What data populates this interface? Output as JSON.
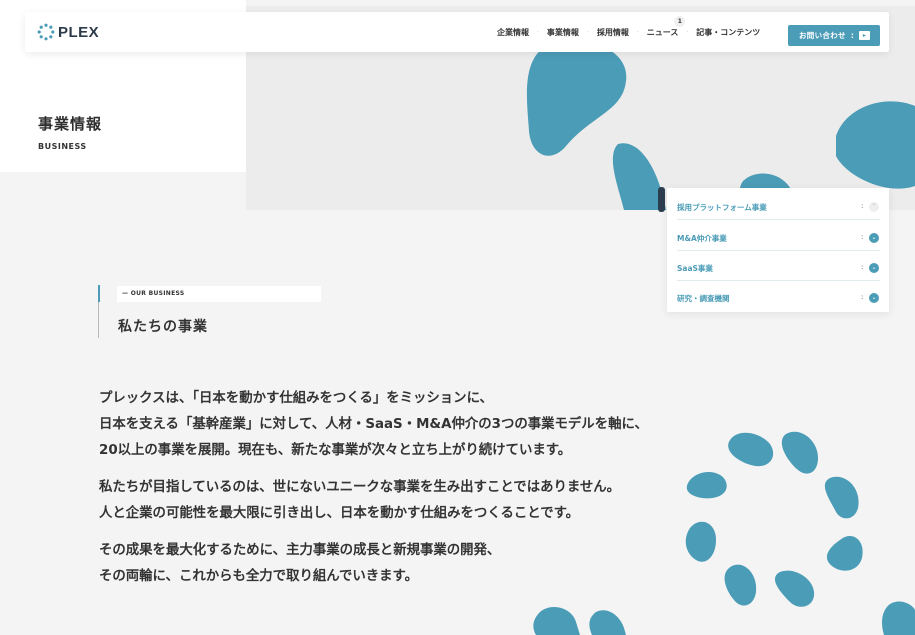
{
  "header": {
    "logo_text": "PLEX",
    "nav": [
      {
        "label": "企業情報"
      },
      {
        "label": "事業情報"
      },
      {
        "label": "採用情報"
      },
      {
        "label": "ニュース",
        "badge": "1"
      },
      {
        "label": "記事・コンテンツ"
      }
    ],
    "contact_label": "お問い合わせ",
    "contact_colon": ":",
    "contact_arrow": "▸"
  },
  "page": {
    "title": "事業情報",
    "subtitle": "BUSINESS"
  },
  "side_menu": {
    "items": [
      {
        "label": "採用プラットフォーム事業",
        "colon": ":",
        "icon": "chevron-up-icon",
        "icon_glyph": "⌃",
        "active": false
      },
      {
        "label": "M&A仲介事業",
        "colon": ":",
        "icon": "chevron-down-icon",
        "icon_glyph": "⌄",
        "active": true
      },
      {
        "label": "SaaS事業",
        "colon": ":",
        "icon": "chevron-down-icon",
        "icon_glyph": "⌄",
        "active": true
      },
      {
        "label": "研究・調査機関",
        "colon": ":",
        "icon": "chevron-down-icon",
        "icon_glyph": "⌄",
        "active": true
      }
    ]
  },
  "section": {
    "eyebrow": "— OUR BUSINESS",
    "title": "私たちの事業"
  },
  "body": {
    "paragraphs": [
      [
        "プレックスは、「日本を動かす仕組みをつくる」をミッションに、",
        "日本を支える「基幹産業」に対して、人材・SaaS・M&A仲介の3つの事業モデルを軸に、",
        "20以上の事業を展開。現在も、新たな事業が次々と立ち上がり続けています。"
      ],
      [
        "私たちが目指しているのは、世にないユニークな事業を生み出すことではありません。",
        "人と企業の可能性を最大限に引き出し、日本を動かす仕組みをつくることです。"
      ],
      [
        "その成果を最大化するために、主力事業の成長と新規事業の開発、",
        "その両輪に、これからも全力で取り組んでいきます。"
      ]
    ]
  },
  "colors": {
    "accent": "#4b9cb7",
    "dark": "#2c3e50",
    "background": "#f4f4f4"
  }
}
